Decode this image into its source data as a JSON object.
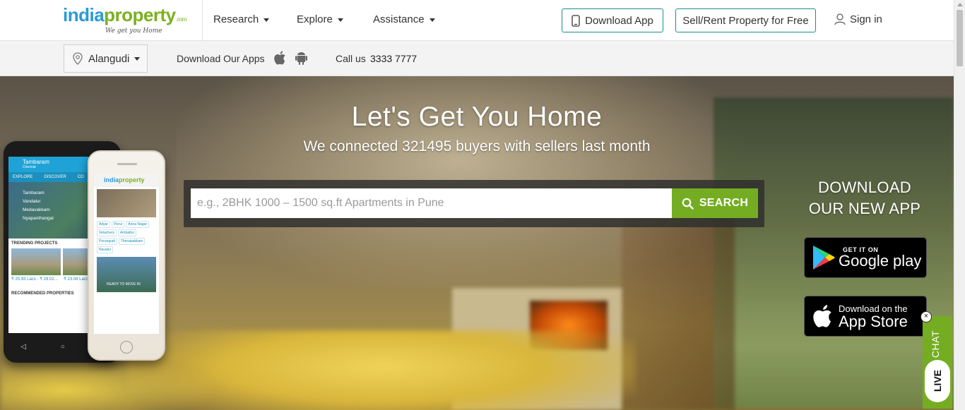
{
  "brand": {
    "logo_part1": "india",
    "logo_part2": "property",
    "logo_suffix": ".com",
    "tagline": "We get you Home",
    "primary_color": "#2a9bd6",
    "accent_color": "#7ab11e"
  },
  "nav": {
    "items": [
      {
        "label": "Research"
      },
      {
        "label": "Explore"
      },
      {
        "label": "Assistance"
      }
    ],
    "download_app": "Download App",
    "sell_rent": "Sell/Rent Property for Free",
    "sign_in": "Sign in"
  },
  "subbar": {
    "city": "Alangudi",
    "download_apps_label": "Download Our Apps",
    "call_label": "Call us",
    "phone": "3333 7777"
  },
  "hero": {
    "title": "Let's Get You Home",
    "subtitle": "We connected 321495 buyers with sellers last month",
    "search": {
      "placeholder": "e.g., 2BHK 1000 – 1500 sq.ft Apartments in Pune",
      "value": "",
      "button": "SEARCH"
    },
    "download": {
      "line1": "DOWNLOAD",
      "line2": "OUR NEW APP",
      "google_small": "GET IT ON",
      "google_big": "Google play",
      "apple_small": "Download on the",
      "apple_big": "App Store"
    }
  },
  "phone_android": {
    "location": "Tambaram",
    "location_sub": "Chennai",
    "tabs": [
      "EXPLORE",
      "DISCOVER",
      "CO"
    ],
    "map_places": [
      "Tambaram",
      "Vandalur",
      "Medavakkam",
      "Nyapanthangal"
    ],
    "trending_label": "TRENDING PROJECTS",
    "price1": "₹ 25.93 Lacs - ₹ 29.02...",
    "price2": "₹ 23.08 Lacs",
    "recommended_label": "RECOMMENDED PROPERTIES"
  },
  "phone_iphone": {
    "logo1": "india",
    "logo2": "property",
    "chips": [
      "Adyar",
      "Porur",
      "Anna Nagar",
      "Velachery",
      "Ambattur",
      "Perungudi",
      "Thoraipakkam",
      "Navalur"
    ],
    "photo_caption": "READY TO MOVE IN"
  },
  "live_chat": {
    "top": "CHAT",
    "bottom": "LIVE",
    "close": "×"
  }
}
